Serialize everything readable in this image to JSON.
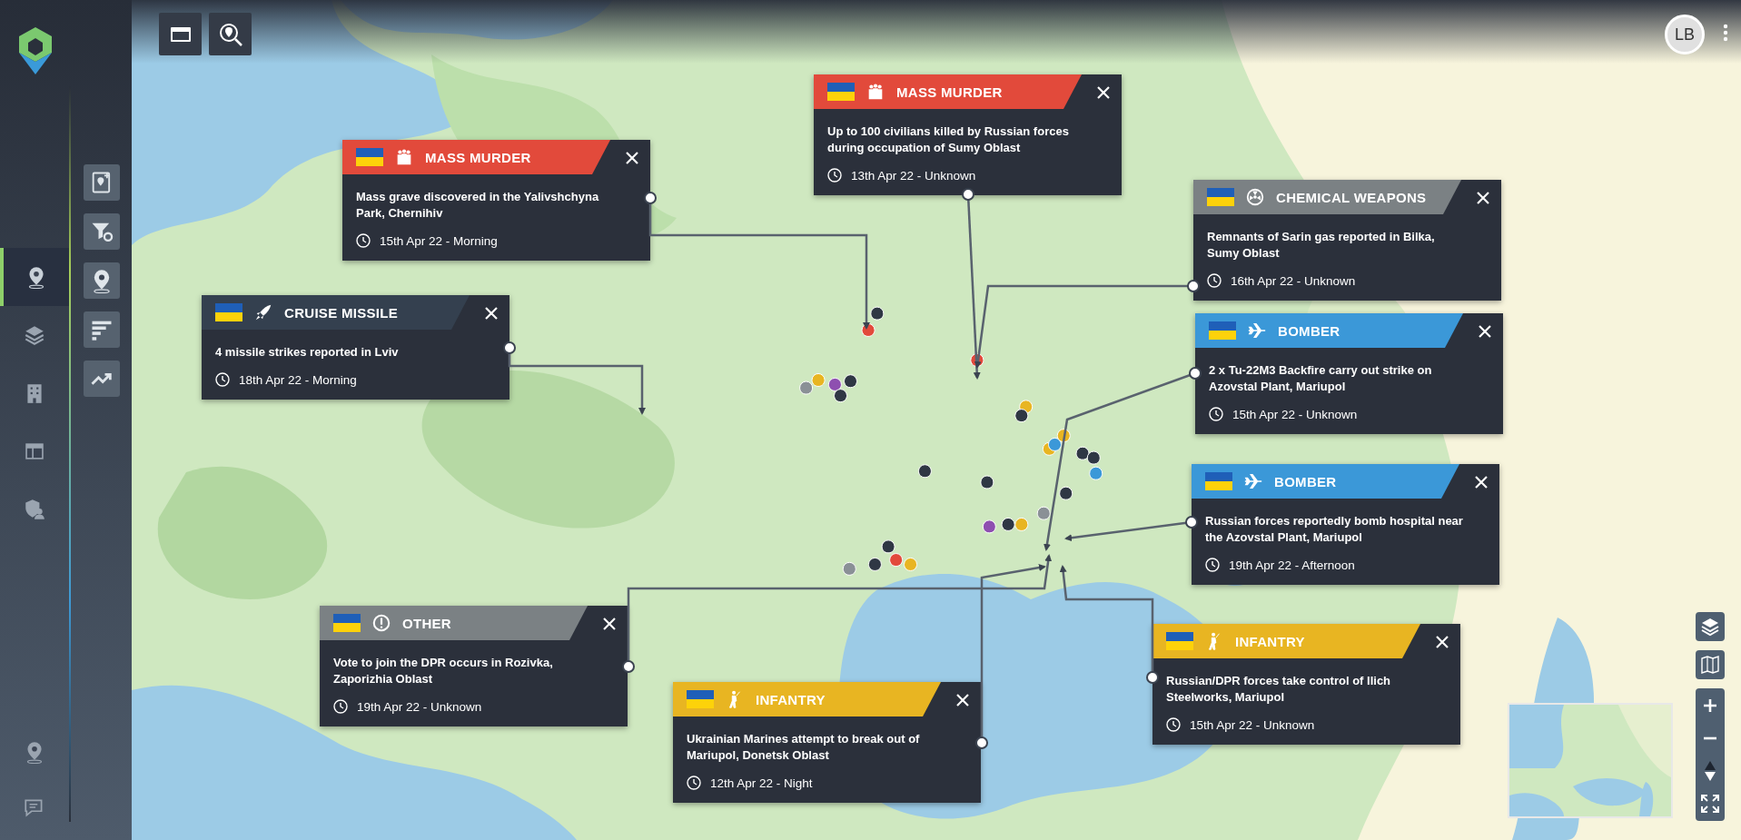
{
  "sidebar": {
    "items": [
      {
        "selected": true
      },
      {
        "selected": false
      },
      {
        "selected": false
      },
      {
        "selected": false
      },
      {
        "selected": false
      }
    ],
    "footer_items": [
      {
        "selected": false
      },
      {
        "selected": false
      }
    ],
    "tools": [
      {
        "selected": false
      },
      {
        "selected": false
      },
      {
        "selected": false
      },
      {
        "selected": false
      },
      {
        "selected": false
      }
    ]
  },
  "user": {
    "initials": "LB"
  },
  "events": [
    {
      "kind": "mass_murder",
      "color": "#e24a3b",
      "category": "MASS MURDER",
      "title": "Mass grave discovered in the Yalivshchyna Park, Chernihiv",
      "date": "15th Apr 22 - Morning"
    },
    {
      "kind": "mass_murder",
      "color": "#e24a3b",
      "category": "MASS MURDER",
      "title": "Up to 100 civilians killed by Russian forces during occupation of Sumy Oblast",
      "date": "13th Apr 22 - Unknown"
    },
    {
      "kind": "chemical",
      "color": "#7b8184",
      "category": "CHEMICAL WEAPONS",
      "title": "Remnants of Sarin gas reported in Bilka, Sumy Oblast",
      "date": "16th Apr 22 - Unknown"
    },
    {
      "kind": "missile",
      "color": "#34404f",
      "category": "CRUISE MISSILE",
      "title": "4 missile strikes reported in Lviv",
      "date": "18th Apr 22 - Morning"
    },
    {
      "kind": "plane",
      "color": "#3b98d8",
      "category": "BOMBER",
      "title": "2 x Tu-22M3 Backfire carry out strike on Azovstal Plant, Mariupol",
      "date": "15th Apr 22 - Unknown"
    },
    {
      "kind": "plane",
      "color": "#3b98d8",
      "category": "BOMBER",
      "title": "Russian forces reportedly bomb hospital near the Azovstal Plant, Mariupol",
      "date": "19th Apr 22 - Afternoon"
    },
    {
      "kind": "other",
      "color": "#7b8184",
      "category": "OTHER",
      "title": "Vote to join the DPR occurs in Rozivka, Zaporizhia Oblast",
      "date": "19th Apr 22 - Unknown"
    },
    {
      "kind": "infantry",
      "color": "#e8b522",
      "category": "INFANTRY",
      "title": "Ukrainian Marines attempt to break out of Mariupol, Donetsk Oblast",
      "date": "12th Apr 22 - Night"
    },
    {
      "kind": "infantry",
      "color": "#e8b522",
      "category": "INFANTRY",
      "title": "Russian/DPR forces take control of Ilich Steelworks, Mariupol",
      "date": "15th Apr 22 - Unknown"
    }
  ],
  "map_markers": [
    {
      "color": "#e24a3b"
    },
    {
      "color": "#2f3744"
    },
    {
      "color": "#8a9096"
    },
    {
      "color": "#e8b522"
    },
    {
      "color": "#8e4fb0"
    },
    {
      "color": "#2f3744"
    },
    {
      "color": "#2f3744"
    },
    {
      "color": "#e24a3b"
    },
    {
      "color": "#e8b522"
    },
    {
      "color": "#2f3744"
    },
    {
      "color": "#e8b522"
    },
    {
      "color": "#3b98d8"
    },
    {
      "color": "#2f3744"
    },
    {
      "color": "#2f3744"
    },
    {
      "color": "#3b98d8"
    },
    {
      "color": "#e8b522"
    },
    {
      "color": "#2f3744"
    },
    {
      "color": "#2f3744"
    },
    {
      "color": "#8a9096"
    },
    {
      "color": "#2f3744"
    },
    {
      "color": "#2f3744"
    },
    {
      "color": "#8e4fb0"
    },
    {
      "color": "#e8b522"
    },
    {
      "color": "#2f3744"
    },
    {
      "color": "#e24a3b"
    },
    {
      "color": "#e8b522"
    },
    {
      "color": "#2f3744"
    },
    {
      "color": "#8a9096"
    }
  ]
}
